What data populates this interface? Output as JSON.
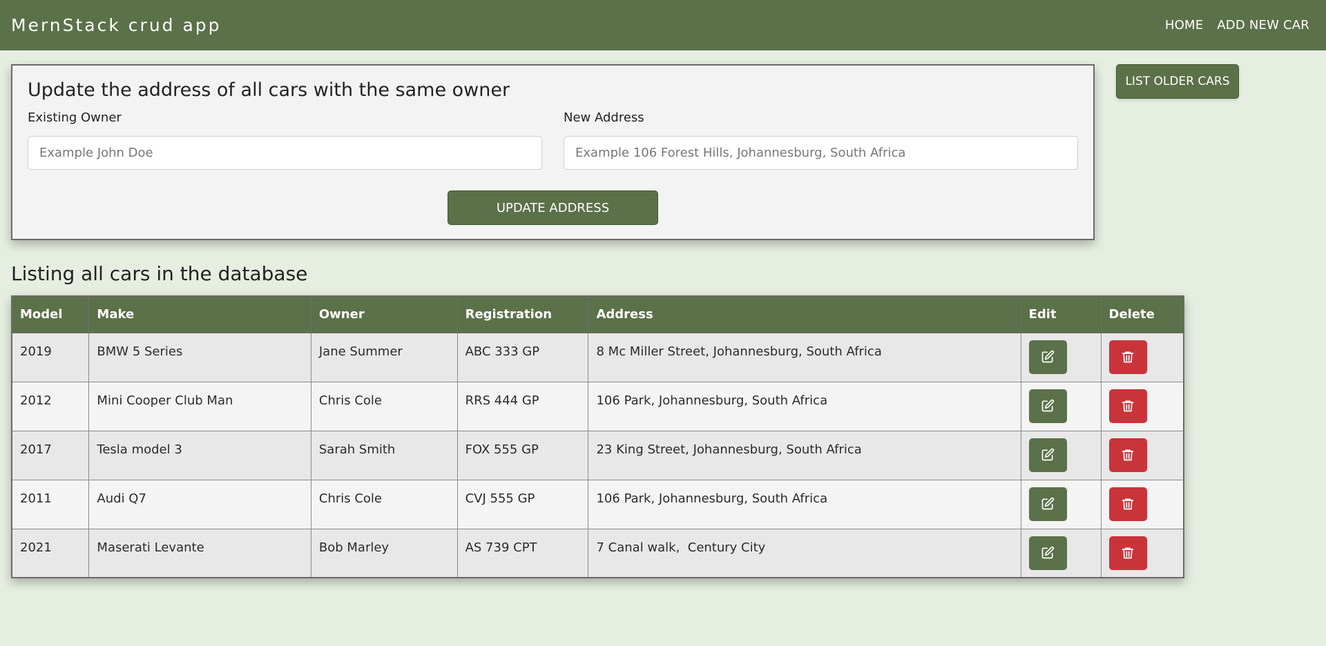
{
  "navbar": {
    "brand": "MernStack crud app",
    "links": [
      {
        "label": "HOME"
      },
      {
        "label": "ADD NEW CAR"
      }
    ]
  },
  "update_form": {
    "title": "Update the address of all cars with the same owner",
    "owner_label": "Existing Owner",
    "owner_placeholder": "Example John Doe",
    "owner_value": "",
    "address_label": "New Address",
    "address_placeholder": "Example 106 Forest Hills, Johannesburg, South Africa",
    "address_value": "",
    "submit_label": "UPDATE ADDRESS"
  },
  "list_older_label": "LIST OLDER CARS",
  "listing": {
    "heading": "Listing all cars in the database",
    "columns": [
      "Model",
      "Make",
      "Owner",
      "Registration",
      "Address",
      "Edit",
      "Delete"
    ],
    "rows": [
      {
        "model": "2019",
        "make": "BMW 5 Series",
        "owner": "Jane Summer",
        "registration": "ABC 333 GP",
        "address": "8 Mc Miller Street, Johannesburg, South Africa"
      },
      {
        "model": "2012",
        "make": "Mini Cooper Club Man",
        "owner": "Chris Cole",
        "registration": "RRS 444 GP",
        "address": "106 Park, Johannesburg, South Africa"
      },
      {
        "model": "2017",
        "make": "Tesla model 3",
        "owner": "Sarah Smith",
        "registration": "FOX 555 GP",
        "address": "23 King Street, Johannesburg, South Africa"
      },
      {
        "model": "2011",
        "make": "Audi Q7",
        "owner": "Chris Cole",
        "registration": "CVJ 555 GP",
        "address": "106 Park, Johannesburg, South Africa"
      },
      {
        "model": "2021",
        "make": "Maserati Levante",
        "owner": "Bob Marley",
        "registration": "AS 739 CPT",
        "address": "7 Canal walk,  Century City"
      }
    ]
  },
  "icons": {
    "edit": "edit-icon",
    "delete": "trash-icon"
  },
  "colors": {
    "primary": "#5b7149",
    "danger": "#c9343a",
    "background": "#e6eee1"
  }
}
